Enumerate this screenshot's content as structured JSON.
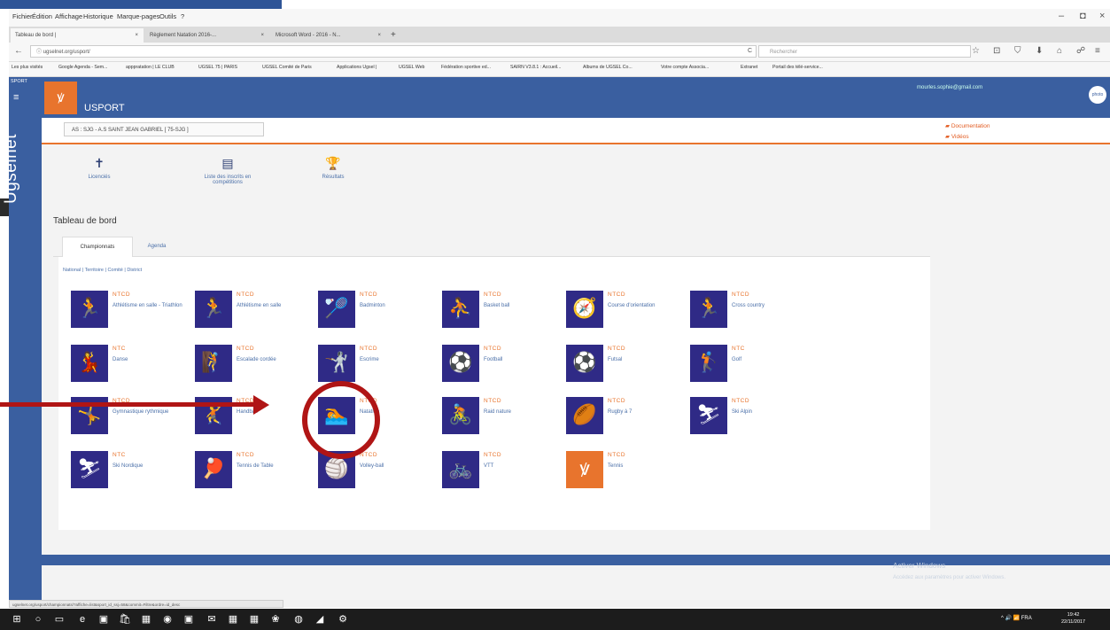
{
  "menu_bar": {
    "items": [
      "Fichier",
      "Édition",
      "Affichage",
      "Historique",
      "Marque-pages",
      "Outils",
      "?"
    ],
    "controls": [
      "–",
      "◘",
      "×"
    ]
  },
  "tabs": [
    {
      "label": "Tableau de bord |",
      "close": "×",
      "active": true
    },
    {
      "label": "Règlement Natation 2016-...",
      "close": "×",
      "active": false
    },
    {
      "label": "Microsoft Word - 2016 - N...",
      "close": "×",
      "active": false
    }
  ],
  "new_tab": "+",
  "nav": {
    "back": "←",
    "info": "ⓘ",
    "url": "ugselnet.org/usport/",
    "reload": "C",
    "search_placeholder": "Rechercher",
    "icons": [
      "☆",
      "⊡",
      "⛉",
      "⬇",
      "⌂",
      "☍",
      "≡"
    ]
  },
  "bookmarks": [
    "Les plus visités",
    "Google Agenda - Sem...",
    "apppratation | LE CLUB",
    "UGSEL 75 | PARIS",
    "UGSEL Comité de Paris",
    "Applications Ugsel |",
    "UGSEL Web",
    "Fédération sportive ed...",
    "SAIRN V3.8.1 : Accueil...",
    "Albums de UGSEL Co...",
    "Votre compte Associa...",
    "Extranet",
    "Portail des télé-service..."
  ],
  "rail": {
    "sport": "SPORT",
    "menu": "≡",
    "brand": "Ugselnet"
  },
  "header": {
    "logo": "ꝟ",
    "app_name": "USPORT",
    "email": "mourles.sophie@gmail.com",
    "avatar": "photo"
  },
  "club": "AS : SJG - A.S SAINT JEAN GABRIEL [ 75-SJG ]",
  "links": {
    "documentation": "Documentation",
    "videos": "Vidéos"
  },
  "quick_links": [
    {
      "icon": "✝",
      "label": "Licenciés"
    },
    {
      "icon": "▤",
      "label": "Liste des inscrits en compétitions"
    },
    {
      "icon": "🏆",
      "label": "Résultats"
    }
  ],
  "dashboard_title": "Tableau de bord",
  "page_tabs": [
    {
      "label": "Championnats",
      "active": true
    },
    {
      "label": "Agenda",
      "active": false
    }
  ],
  "levels": "National | Territoire | Comité | District",
  "sports": [
    {
      "code": "NTCD",
      "name": "Athlétisme en salle - Triathlon",
      "icon": "🏃"
    },
    {
      "code": "NTCD",
      "name": "Athlétisme en salle",
      "icon": "🏃"
    },
    {
      "code": "NTCD",
      "name": "Badminton",
      "icon": "🏸"
    },
    {
      "code": "NTCD",
      "name": "Basket ball",
      "icon": "⛹"
    },
    {
      "code": "NTCD",
      "name": "Course d'orientation",
      "icon": "🧭"
    },
    {
      "code": "NTCD",
      "name": "Cross country",
      "icon": "🏃"
    },
    {
      "code": "NTC",
      "name": "Danse",
      "icon": "💃"
    },
    {
      "code": "NTCD",
      "name": "Escalade cordée",
      "icon": "🧗"
    },
    {
      "code": "NTCD",
      "name": "Escrime",
      "icon": "🤺"
    },
    {
      "code": "NTCD",
      "name": "Football",
      "icon": "⚽"
    },
    {
      "code": "NTCD",
      "name": "Futsal",
      "icon": "⚽"
    },
    {
      "code": "NTC",
      "name": "Golf",
      "icon": "🏌"
    },
    {
      "code": "NTCD",
      "name": "Gymnastique rythmique",
      "icon": "🤸"
    },
    {
      "code": "NTCD",
      "name": "Handball",
      "icon": "🤾"
    },
    {
      "code": "NTCD",
      "name": "Natation",
      "icon": "🏊"
    },
    {
      "code": "NTCD",
      "name": "Raid nature",
      "icon": "🚴"
    },
    {
      "code": "NTCD",
      "name": "Rugby à 7",
      "icon": "🏉"
    },
    {
      "code": "NTCD",
      "name": "Ski Alpin",
      "icon": "⛷"
    },
    {
      "code": "NTC",
      "name": "Ski Nordique",
      "icon": "⛷"
    },
    {
      "code": "NTCD",
      "name": "Tennis de Table",
      "icon": "🏓"
    },
    {
      "code": "NTCD",
      "name": "Volley-ball",
      "icon": "🏐"
    },
    {
      "code": "NTCD",
      "name": "VTT",
      "icon": "🚲"
    },
    {
      "code": "NTCD",
      "name": "Tennis",
      "icon": "ꝟ",
      "orange": true
    }
  ],
  "activate_windows": {
    "title": "Activer Windows",
    "subtitle": "Accédez aux paramètres pour activer Windows."
  },
  "status_url": "ugselnet.org/usport/championnats/?affiche=list&sport_id_ssj=58&commit=Filtre&ordre=id_desc",
  "taskbar": {
    "icons": [
      "⊞",
      "○",
      "▭",
      "e",
      "▣",
      "🛍",
      "▦",
      "◉",
      "▣",
      "✉",
      "▦",
      "▦",
      "❀",
      "◍",
      "◢",
      "⚙"
    ],
    "tray": "^ 🔊 📶 FRA",
    "time": "19:42",
    "date": "22/11/2017"
  },
  "colors": {
    "brand_blue": "#3a5fa0",
    "sport_tile": "#2f2a86",
    "accent_orange": "#e8742d",
    "annotation_red": "#b01515"
  }
}
